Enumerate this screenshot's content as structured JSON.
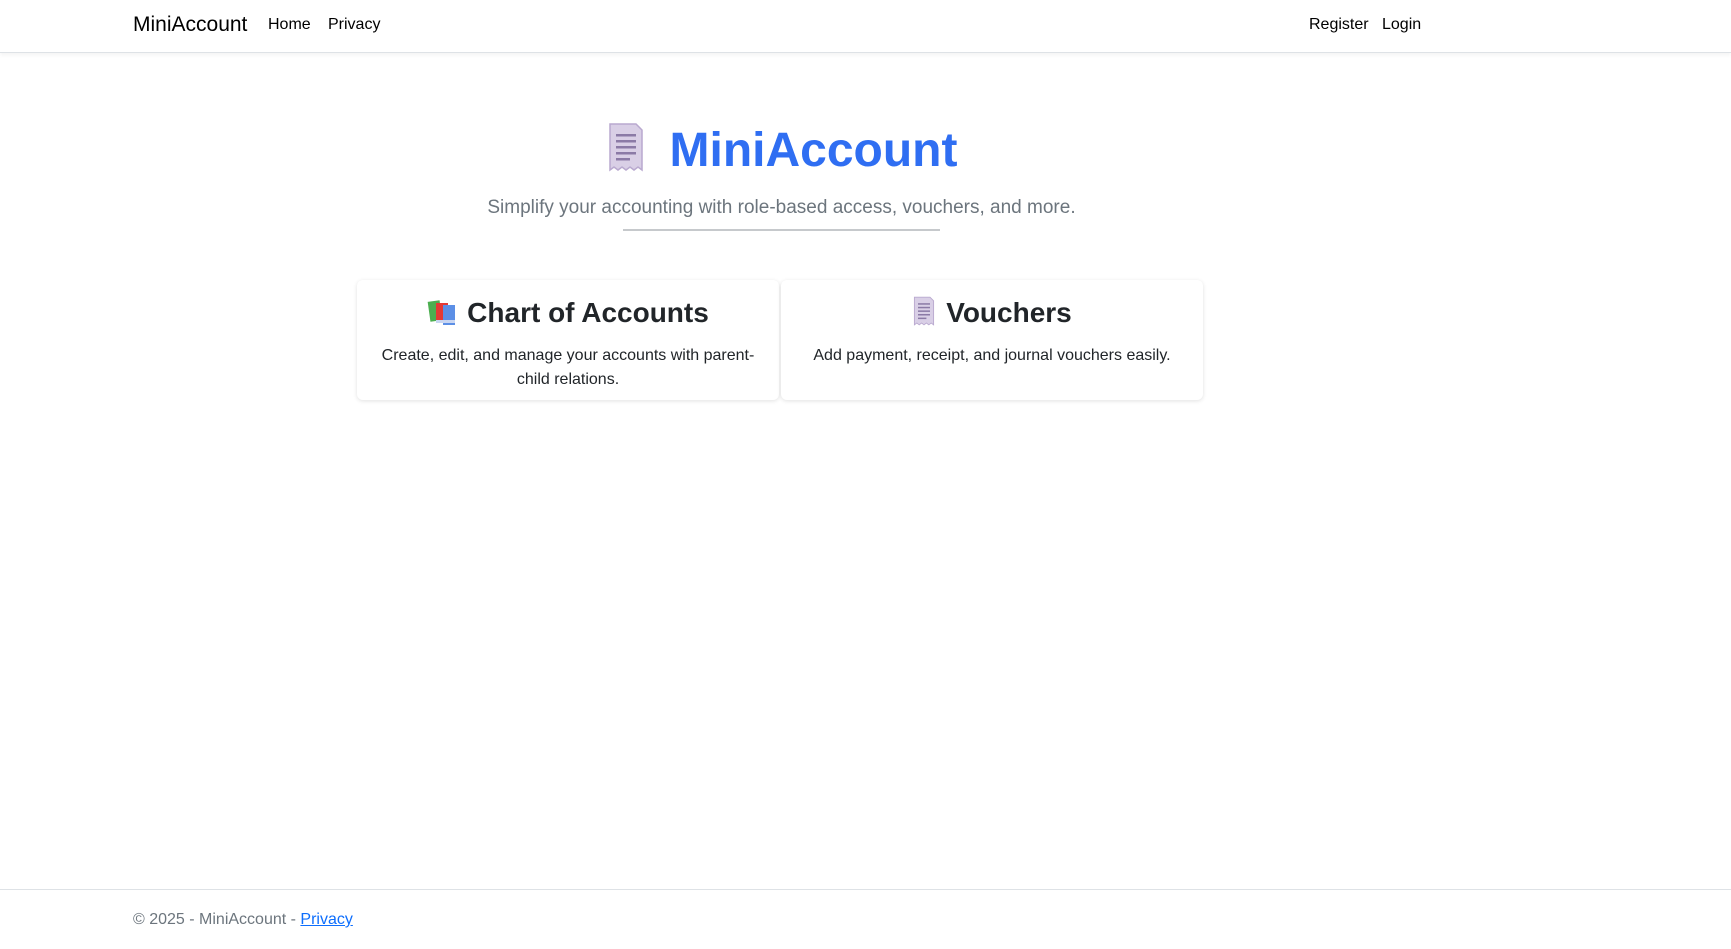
{
  "navbar": {
    "brand": "MiniAccount",
    "left_links": [
      "Home",
      "Privacy"
    ],
    "right_links": [
      "Register",
      "Login"
    ]
  },
  "hero": {
    "icon": "receipt-icon",
    "title": "MiniAccount",
    "subtitle": "Simplify your accounting with role-based access, vouchers, and more."
  },
  "cards": [
    {
      "icon": "books-icon",
      "title": "Chart of Accounts",
      "text": "Create, edit, and manage your accounts with parent-child relations."
    },
    {
      "icon": "receipt-icon",
      "title": "Vouchers",
      "text": "Add payment, receipt, and journal vouchers easily."
    }
  ],
  "footer": {
    "text": "© 2025 - MiniAccount - ",
    "link": "Privacy"
  },
  "colors": {
    "accent": "#2f6ef2",
    "muted": "#6c757d",
    "link": "#0d6efd"
  }
}
